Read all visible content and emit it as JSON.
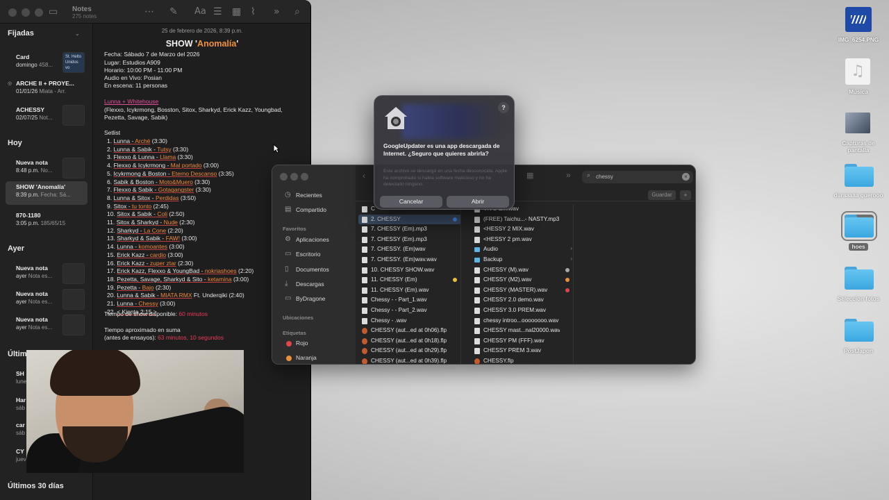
{
  "notes": {
    "app_title": "Notes",
    "app_count": "275 notes",
    "sections": {
      "pinned": "Fijadas",
      "today": "Hoy",
      "yesterday": "Ayer",
      "last7": "Últimos",
      "last30": "Últimos 30 días"
    },
    "pinned_items": [
      {
        "title": "Card",
        "date": "domingo",
        "preview": "458...",
        "thumb": "St. Helto\nUnidos\nvo"
      },
      {
        "title": "ARCHE II + PROYE...",
        "date": "01/01/26",
        "preview": "Miata - Arr..."
      },
      {
        "title": "ACHESSY",
        "date": "02/07/25",
        "preview": "Not..."
      }
    ],
    "today_items": [
      {
        "title": "Nueva nota",
        "date": "8:48 p.m.",
        "preview": "No..."
      },
      {
        "title": "SHOW 'Anomalía'",
        "date": "8:39 p.m.",
        "preview": "Fecha: Sá..."
      },
      {
        "title": "870-1180",
        "date": "3:05 p.m.",
        "preview": "185/65/15"
      }
    ],
    "yesterday_items": [
      {
        "title": "Nueva nota",
        "date": "ayer",
        "preview": "Nota es..."
      },
      {
        "title": "Nueva nota",
        "date": "ayer",
        "preview": "Nota es..."
      },
      {
        "title": "Nueva nota",
        "date": "ayer",
        "preview": "Nota es..."
      }
    ],
    "last7_items": [
      {
        "title": "SH",
        "date": "lune"
      },
      {
        "title": "Har",
        "date": "sáb"
      },
      {
        "title": "car",
        "date": "sáb"
      },
      {
        "title": "CY",
        "date": "juev"
      }
    ],
    "editor": {
      "date": "25 de febrero de 2026, 8:39 p.m.",
      "title_prefix": "SHOW '",
      "title_accent": "Anomalía",
      "title_suffix": "'",
      "info": [
        "Fecha: Sábado 7 de Marzo del 2026",
        "Lugar: Estudios A909",
        "Horario: 10:00 PM - 11:00 PM",
        "Audio en Vivo: Posian",
        "En escena: 11 personas"
      ],
      "headliners": "Lunna + Whitehouse",
      "guests1": "(Flexxo, Icykrmong, Bosston, Sitox, Sharkyd, Erick Kazz, Youngbad,",
      "guests2": "Pezetta, Savage, Sabik)",
      "setlist_label": "Setlist",
      "setlist": [
        {
          "n": "1.",
          "artist": "Lunna - ",
          "song": "Arché",
          "time": " (3:30)"
        },
        {
          "n": "2.",
          "artist": "Lunna & Sabik - ",
          "song": "Tutsy",
          "time": " (3:30)"
        },
        {
          "n": "3.",
          "artist": "Flexxo & Lunna - ",
          "song": "Llama",
          "time": " (3:30)"
        },
        {
          "n": "4.",
          "artist": "Flexxo & Icykrmong - ",
          "song": "Mal portado",
          "time": " (3:00)"
        },
        {
          "n": "5.",
          "artist": "Icykrmong & Boston - ",
          "song": "Eterno Descanso",
          "time": " (3:35)"
        },
        {
          "n": "6.",
          "artist": "Sabik & Boston - ",
          "song": "Moto&Muero",
          "time": " (3:30)"
        },
        {
          "n": "7.",
          "artist": "Flexxo & Sabik - ",
          "song": "Gotagangster",
          "time": " (3:30)"
        },
        {
          "n": "8.",
          "artist": "Lunna & Sitox - ",
          "song": "Perdidas",
          "time": " (3:50)"
        },
        {
          "n": "9.",
          "artist": "Sitox - ",
          "song": "tu tonto",
          "time": " (2:45)"
        },
        {
          "n": "10.",
          "artist": "Sitox & Sabik - ",
          "song": "Coli",
          "time": " (2:50)"
        },
        {
          "n": "11.",
          "artist": "Sitox & Sharkyd - ",
          "song": "Nude",
          "time": " (2:30)"
        },
        {
          "n": "12.",
          "artist": "Sharkyd - ",
          "song": "La Cone",
          "time": " (2:20)"
        },
        {
          "n": "13.",
          "artist": "Sharkyd & Sabik - ",
          "song": "FAW!",
          "time": " (3:00)"
        },
        {
          "n": "14.",
          "artist": "Lunna - ",
          "song": "komoantes",
          "time": " (3:00)"
        },
        {
          "n": "15.",
          "artist": "Erick Kazz - ",
          "song": "cardio",
          "time": " (3:00)"
        },
        {
          "n": "16.",
          "artist": "Erick Kazz - ",
          "song": "zuper ztar",
          "time": " (2:30)"
        },
        {
          "n": "17.",
          "artist": "Erick Kazz, Flexxo & YoungBad - ",
          "song": "nokriashoes",
          "time": " (2:20)"
        },
        {
          "n": "18.",
          "artist": "Pezetta, Savage, Sharkyd & Sito - ",
          "song": "ketamina",
          "time": " (3:00)"
        },
        {
          "n": "19.",
          "artist": "Pezetta - ",
          "song": "Bajo",
          "time": " (2:30)"
        },
        {
          "n": "20.",
          "artist": "Lunna & Sabik - ",
          "song": "MIATA RMX",
          "time": " Ft. Underqiki (2:40)"
        },
        {
          "n": "21.",
          "artist": "Lunna - ",
          "song": "Chessy",
          "time": " (3:00)"
        },
        {
          "n": "22.",
          "artist": "< Kiente  2:15 >",
          "song": "",
          "time": ""
        }
      ],
      "show_time_label": "Tiempo de show disponible: ",
      "show_time_value": "60 minutos",
      "approx_label": "Tiempo aproximado en suma",
      "approx_prefix": " (antes de ensayos): ",
      "approx_value": "63 minutos, 10 segundos"
    }
  },
  "finder": {
    "sidebar": {
      "recents": "Recientes",
      "shared": "Compartido",
      "favorites_label": "Favoritos",
      "favorites": [
        "Aplicaciones",
        "Escritorio",
        "Documentos",
        "Descargas",
        "ByDragone"
      ],
      "locations_label": "Ubicaciones",
      "tags_label": "Etiquetas",
      "tags": [
        {
          "name": "Rojo",
          "color": "#e0444c"
        },
        {
          "name": "Naranja",
          "color": "#e8913a"
        }
      ]
    },
    "search_value": "chessy",
    "save_label": "Guardar",
    "col1": [
      {
        "name": "C",
        "kind": "file"
      },
      {
        "name": "2. CHESSY",
        "kind": "file",
        "selected": true,
        "tag": "#3b8ce6"
      },
      {
        "name": "7. CHESSY (Em).mp3",
        "kind": "file"
      },
      {
        "name": "7. CHESSY (Em).mp3",
        "kind": "file"
      },
      {
        "name": "7. CHESSY. (Em)wav",
        "kind": "file"
      },
      {
        "name": "7. CHESSY. (Em)wav.wav",
        "kind": "file"
      },
      {
        "name": "10. CHESSY SHOW.wav",
        "kind": "file"
      },
      {
        "name": "11. CHESSY (Em)",
        "kind": "file",
        "tag": "#e8c33a"
      },
      {
        "name": "11. CHESSY (Em).wav",
        "kind": "file"
      },
      {
        "name": "Chessy -  - Part_1.wav",
        "kind": "file"
      },
      {
        "name": "Chessy -  - Part_2.wav",
        "kind": "file"
      },
      {
        "name": "Chessy - .wav",
        "kind": "file"
      },
      {
        "name": "CHESSY (aut...ed at 0h06).flp",
        "kind": "flp"
      },
      {
        "name": "CHESSY (aut...ed at 0h18).flp",
        "kind": "flp"
      },
      {
        "name": "CHESSY (aut...ed at 0h29).flp",
        "kind": "flp"
      },
      {
        "name": "CHESSY (aut...ed at 0h39).flp",
        "kind": "flp"
      }
    ],
    "col2": [
      {
        "name": "VIVO Em.wav",
        "kind": "file"
      },
      {
        "name": "(FREE) Taichu...- NASTY.mp3",
        "kind": "file"
      },
      {
        "name": "<HESSY 2 MIX.wav",
        "kind": "file"
      },
      {
        "name": "<HESSY 2 pm.wav",
        "kind": "file"
      },
      {
        "name": "Audio",
        "kind": "folder"
      },
      {
        "name": "Backup",
        "kind": "folder"
      },
      {
        "name": "CHESSY (M).wav",
        "kind": "file",
        "tag": "#a8a8a8"
      },
      {
        "name": "CHESSY (M2).wav",
        "kind": "file",
        "tag": "#e8913a"
      },
      {
        "name": "CHESSY (MASTER).wav",
        "kind": "file",
        "tag": "#e0444c"
      },
      {
        "name": "CHESSY 2.0 demo.wav",
        "kind": "file"
      },
      {
        "name": "CHESSY 3.0 PREM.wav",
        "kind": "file"
      },
      {
        "name": "chessy introo...oooooooo.wav",
        "kind": "file"
      },
      {
        "name": "CHESSY mast...nal20000.wav",
        "kind": "file"
      },
      {
        "name": "CHESSY PM (FFF).wav",
        "kind": "file"
      },
      {
        "name": "CHESSY PREM 3.wav",
        "kind": "file"
      },
      {
        "name": "CHESSY.flp",
        "kind": "flp"
      }
    ]
  },
  "alert": {
    "title": "GoogleUpdater es una app descargada de Internet. ¿Seguro que quieres abrirla?",
    "body": "Este archivo se descargó en una fecha desconocida. Apple ha comprobado si había software malicioso y no ha detectado ninguno.",
    "cancel_label": "Cancelar",
    "open_label": "Abrir",
    "help_label": "?"
  },
  "desktop": [
    {
      "label": "IMG_6254.PNG",
      "kind": "image"
    },
    {
      "label": "Música",
      "kind": "music"
    },
    {
      "label": "Capturas de pantalla",
      "kind": "screenshots"
    },
    {
      "label": "duraaaaa guerooo",
      "kind": "folder"
    },
    {
      "label": "hoes",
      "kind": "folder",
      "selected": true
    },
    {
      "label": "Seleccion fotos",
      "kind": "folder"
    },
    {
      "label": "PostJapon",
      "kind": "folder"
    }
  ]
}
